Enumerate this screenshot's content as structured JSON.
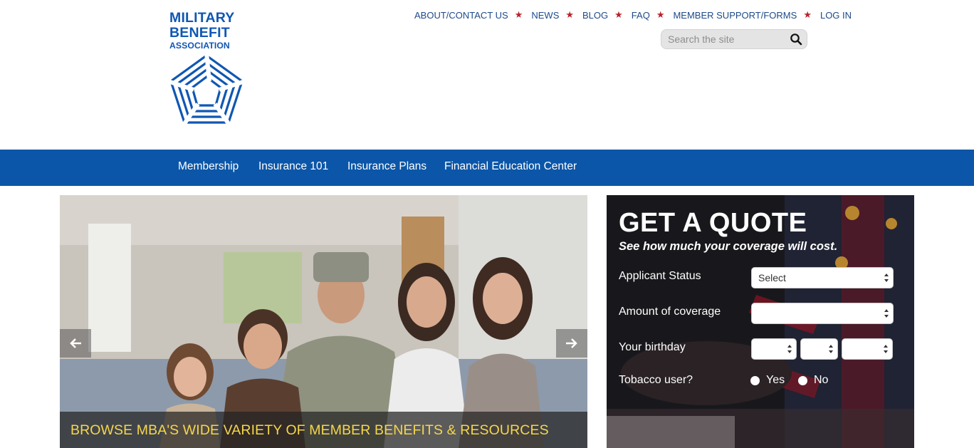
{
  "logo": {
    "line1": "MILITARY",
    "line2": "BENEFIT",
    "line3": "ASSOCIATION"
  },
  "topnav": {
    "items": [
      "ABOUT/CONTACT US",
      "NEWS",
      "BLOG",
      "FAQ",
      "MEMBER SUPPORT/FORMS",
      "LOG IN"
    ],
    "separator": "★"
  },
  "search": {
    "placeholder": "Search the site",
    "icon": "search-icon"
  },
  "mainnav": {
    "items": [
      "Membership",
      "Insurance 101",
      "Insurance Plans",
      "Financial Education Center"
    ]
  },
  "hero": {
    "caption": "BROWSE MBA'S WIDE VARIETY OF MEMBER BENEFITS & RESOURCES",
    "prev_icon": "arrow-left-icon",
    "next_icon": "arrow-right-icon"
  },
  "quote": {
    "title": "GET A QUOTE",
    "subtitle": "See how much your coverage will cost.",
    "applicant_label": "Applicant Status",
    "applicant_value": "Select",
    "coverage_label": "Amount of coverage",
    "coverage_value": "",
    "birthday_label": "Your birthday",
    "tobacco_label": "Tobacco user?",
    "yes": "Yes",
    "no": "No"
  },
  "colors": {
    "brand_blue": "#0b56a8",
    "star_red": "#b8242c",
    "caption_yellow": "#f5d64d"
  }
}
